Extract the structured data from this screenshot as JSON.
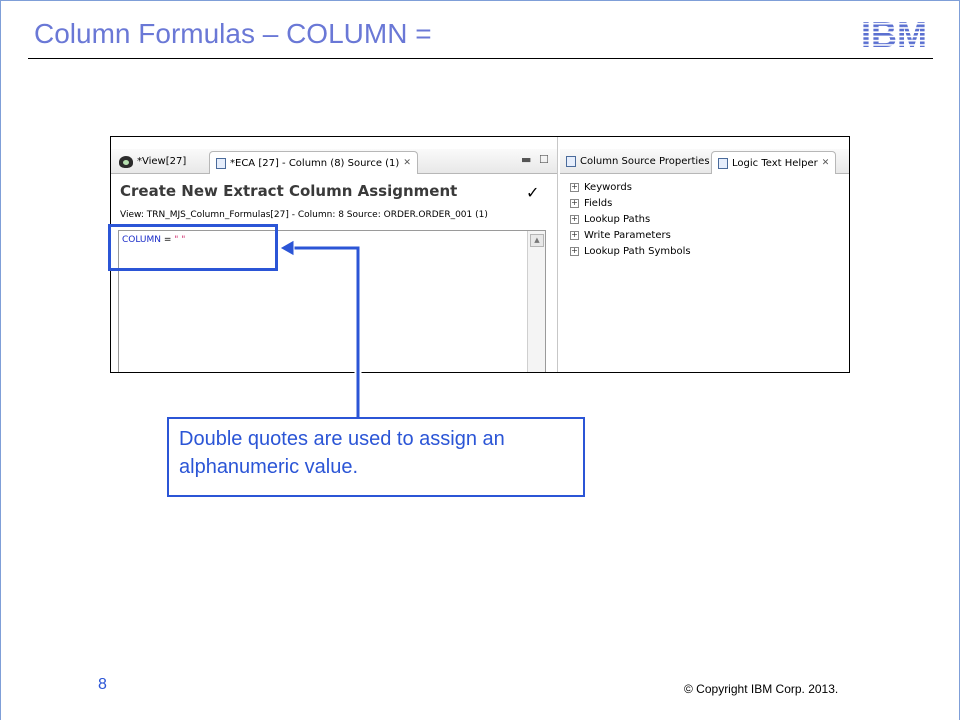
{
  "slide": {
    "title": "Column Formulas – COLUMN =",
    "page_number": "8",
    "copyright": "© Copyright  IBM Corp.  2013.",
    "logo_text": "IBM"
  },
  "ui": {
    "tabs_left": [
      {
        "label": "*View[27]"
      },
      {
        "label": "*ECA [27] - Column (8) Source (1)"
      }
    ],
    "tabs_right": [
      {
        "label": "Column Source Properties"
      },
      {
        "label": "Logic Text Helper"
      }
    ],
    "editor": {
      "heading": "Create New Extract Column Assignment",
      "info": "View: TRN_MJS_Column_Formulas[27] - Column: 8 Source: ORDER.ORDER_001 (1)",
      "code_keyword": "COLUMN",
      "code_operator": " = ",
      "code_string": "\"  \""
    },
    "helper_tree": [
      {
        "label": "Keywords"
      },
      {
        "label": "Fields"
      },
      {
        "label": "Lookup Paths"
      },
      {
        "label": "Write Parameters"
      },
      {
        "label": "Lookup Path Symbols"
      }
    ]
  },
  "callout": {
    "line1": "Double quotes are used to assign an",
    "line2": "alphanumeric value."
  },
  "colors": {
    "title": "#6a78d6",
    "accent": "#2b55d6",
    "keyword": "#1a2cc8",
    "string": "#d02f6e"
  }
}
